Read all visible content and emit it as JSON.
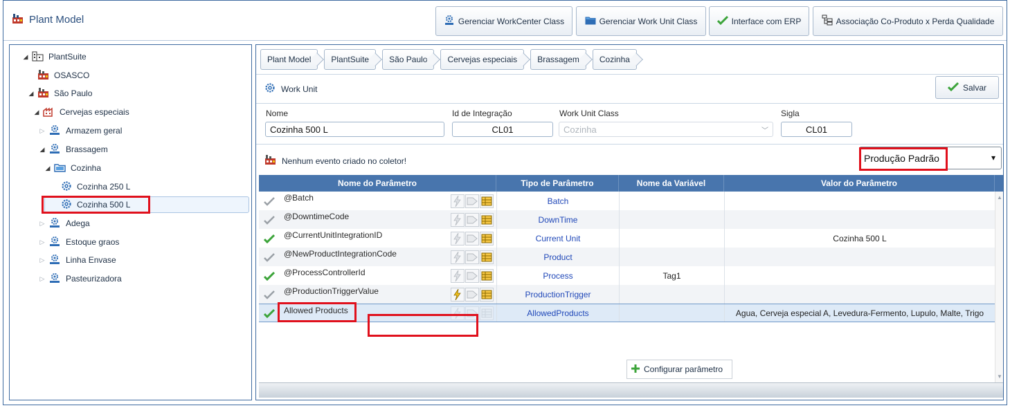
{
  "app": {
    "title": "Plant Model"
  },
  "header_buttons": [
    {
      "label": "Gerenciar WorkCenter Class",
      "icon": "gears-icon"
    },
    {
      "label": "Gerenciar Work Unit Class",
      "icon": "folder-icon"
    },
    {
      "label": "Interface com ERP",
      "icon": "check-icon"
    },
    {
      "label": "Associação Co-Produto x Perda Qualidade",
      "icon": "hierarchy-icon"
    }
  ],
  "tree": {
    "items": [
      {
        "label": "PlantSuite",
        "toggle": "expanded"
      },
      {
        "label": "OSASCO",
        "toggle": "none"
      },
      {
        "label": "São Paulo",
        "toggle": "expanded"
      },
      {
        "label": "Cervejas especiais",
        "toggle": "expanded"
      },
      {
        "label": "Armazem geral",
        "toggle": "collapsed"
      },
      {
        "label": "Brassagem",
        "toggle": "expanded"
      },
      {
        "label": "Cozinha",
        "toggle": "expanded"
      },
      {
        "label": "Cozinha 250 L",
        "toggle": "none"
      },
      {
        "label": "Cozinha 500 L",
        "toggle": "none",
        "selected": true
      },
      {
        "label": "Adega",
        "toggle": "collapsed"
      },
      {
        "label": "Estoque graos",
        "toggle": "collapsed"
      },
      {
        "label": "Linha Envase",
        "toggle": "collapsed"
      },
      {
        "label": "Pasteurizadora",
        "toggle": "collapsed"
      }
    ]
  },
  "breadcrumb": [
    "Plant Model",
    "PlantSuite",
    "São Paulo",
    "Cervejas especiais",
    "Brassagem",
    "Cozinha"
  ],
  "work_unit": {
    "section_title": "Work Unit",
    "save_label": "Salvar",
    "fields": {
      "nome_label": "Nome",
      "nome_value": "Cozinha 500 L",
      "id_label": "Id de Integração",
      "id_value": "CL01",
      "class_label": "Work Unit Class",
      "class_value": "Cozinha",
      "sigla_label": "Sigla",
      "sigla_value": "CL01"
    }
  },
  "events": {
    "message": "Nenhum evento criado no coletor!",
    "selected_option": "Produção Padrão"
  },
  "grid": {
    "headers": [
      "Nome do Parâmetro",
      "Tipo de Parâmetro",
      "Nome da Variável",
      "Valor do Parâmetro"
    ],
    "rows": [
      {
        "name": "@Batch",
        "type": "Batch",
        "variable": "",
        "value": "",
        "checked": false,
        "trigger_active": false
      },
      {
        "name": "@DowntimeCode",
        "type": "DownTime",
        "variable": "",
        "value": "",
        "checked": false,
        "trigger_active": false
      },
      {
        "name": "@CurrentUnitIntegrationID",
        "type": "Current Unit",
        "variable": "",
        "value": "Cozinha 500 L",
        "checked": true,
        "trigger_active": false
      },
      {
        "name": "@NewProductIntegrationCode",
        "type": "Product",
        "variable": "",
        "value": "",
        "checked": false,
        "trigger_active": false
      },
      {
        "name": "@ProcessControllerId",
        "type": "Process",
        "variable": "Tag1",
        "value": "",
        "checked": true,
        "trigger_active": false
      },
      {
        "name": "@ProductionTriggerValue",
        "type": "ProductionTrigger",
        "variable": "",
        "value": "",
        "checked": false,
        "trigger_active": true
      },
      {
        "name": "Allowed Products",
        "type": "AllowedProducts",
        "variable": "",
        "value": "Agua, Cerveja especial A, Levedura-Fermento, Lupulo, Malte, Trigo",
        "checked": true,
        "trigger_active": false,
        "selected": true
      }
    ],
    "context_action": "Configurar parâmetro"
  },
  "colors": {
    "header_blue": "#4875ad",
    "accent_red": "#e0101c",
    "link_blue": "#1f47b8",
    "check_green": "#3ca43a"
  }
}
